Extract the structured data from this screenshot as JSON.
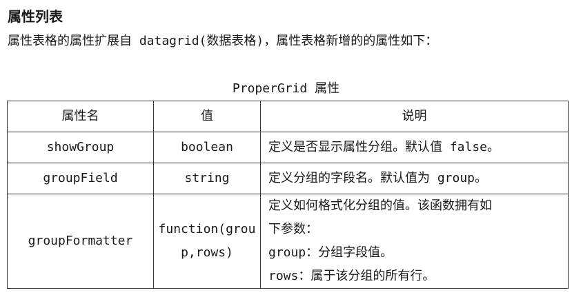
{
  "heading": "属性列表",
  "intro": "属性表格的属性扩展自 datagrid(数据表格)，属性表格新增的的属性如下：",
  "table": {
    "caption": "ProperGrid 属性",
    "headers": [
      "属性名",
      "值",
      "说明"
    ],
    "rows": [
      {
        "name": "showGroup",
        "value": "boolean",
        "desc": [
          "定义是否显示属性分组。默认值 false。"
        ]
      },
      {
        "name": "groupField",
        "value": "string",
        "desc": [
          "定义分组的字段名。默认值为 group。"
        ]
      },
      {
        "name": "groupFormatter",
        "value": "function(group,rows)",
        "desc": [
          "定义如何格式化分组的值。该函数拥有如",
          "下参数：",
          "group：分组字段值。",
          "rows：属于该分组的所有行。"
        ]
      }
    ]
  }
}
